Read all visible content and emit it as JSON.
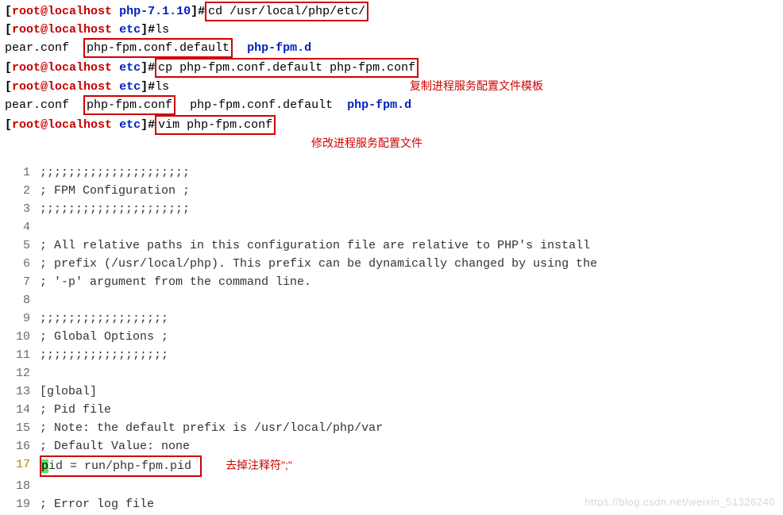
{
  "prompt": {
    "user": "root",
    "at": "@",
    "host_base": "localhost",
    "sep": " ",
    "rbr": "]",
    "hash": "#"
  },
  "lines": {
    "l1_dir": "php-7.1.10",
    "l1_cmd": "cd /usr/local/php/etc/",
    "l2_dir": "etc",
    "l2_cmd": "ls",
    "l3_a": "pear.conf  ",
    "l3_box": "php-fpm.conf.default",
    "l3_b": "  ",
    "l3_dir": "php-fpm.d",
    "l4_dir": "etc",
    "l4_cmd": "cp php-fpm.conf.default php-fpm.conf",
    "l4_ann": "复制进程服务配置文件模板",
    "l5_dir": "etc",
    "l5_cmd": "ls",
    "l6_a": "pear.conf  ",
    "l6_box": "php-fpm.conf",
    "l6_b": "  php-fpm.conf.default  ",
    "l6_dir": "php-fpm.d",
    "l7_dir": "etc",
    "l7_cmd": "vim php-fpm.conf",
    "l7_ann": "修改进程服务配置文件"
  },
  "edit": {
    "r1": ";;;;;;;;;;;;;;;;;;;;;",
    "r2": "; FPM Configuration ;",
    "r3": ";;;;;;;;;;;;;;;;;;;;;",
    "r4": "",
    "r5": "; All relative paths in this configuration file are relative to PHP's install",
    "r6": "; prefix (/usr/local/php). This prefix can be dynamically changed by using the",
    "r7": "; '-p' argument from the command line.",
    "r8": "",
    "r9": ";;;;;;;;;;;;;;;;;;",
    "r10": "; Global Options ;",
    "r11": ";;;;;;;;;;;;;;;;;;",
    "r12": "",
    "r13": "[global]",
    "r14": "; Pid file",
    "r15": "; Note: the default prefix is /usr/local/php/var",
    "r16": "; Default Value: none",
    "r17_hl": "p",
    "r17_rest": "id = run/php-fpm.pid",
    "r17_ann": "去掉注释符\";\"",
    "r18": "",
    "r19": "; Error log file"
  },
  "watermark": "https://blog.csdn.net/weixin_51326240"
}
